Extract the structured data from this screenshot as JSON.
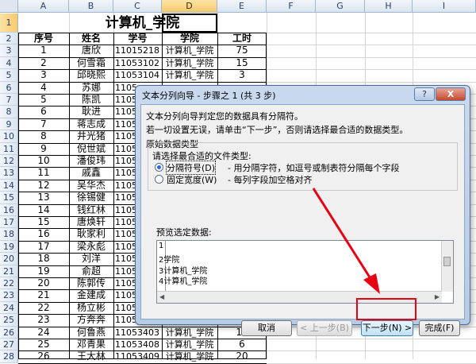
{
  "sheet": {
    "columns": [
      "A",
      "B",
      "C",
      "D",
      "E",
      "F",
      "G",
      "H",
      "I"
    ],
    "selected_column": "D",
    "title": "计算机_学院",
    "headers": [
      "序号",
      "姓名",
      "学号",
      "学院",
      "工时"
    ],
    "rows": [
      {
        "num": "1",
        "name": "唐欣",
        "id": "11015218",
        "dept": "计算机_学院",
        "hours": "75"
      },
      {
        "num": "2",
        "name": "何雪霜",
        "id": "11053102",
        "dept": "计算机_学院",
        "hours": "15"
      },
      {
        "num": "3",
        "name": "邱晓熙",
        "id": "11053104",
        "dept": "计算机_学院",
        "hours": "3"
      },
      {
        "num": "4",
        "name": "苏娜",
        "id": "1105",
        "dept": "",
        "hours": ""
      },
      {
        "num": "5",
        "name": "陈凯",
        "id": "1105",
        "dept": "",
        "hours": ""
      },
      {
        "num": "6",
        "name": "耿进",
        "id": "1105",
        "dept": "",
        "hours": ""
      },
      {
        "num": "7",
        "name": "蒋志成",
        "id": "1105",
        "dept": "",
        "hours": ""
      },
      {
        "num": "8",
        "name": "井光猪",
        "id": "1105",
        "dept": "",
        "hours": ""
      },
      {
        "num": "9",
        "name": "倪世斌",
        "id": "1105",
        "dept": "",
        "hours": ""
      },
      {
        "num": "10",
        "name": "潘俊玮",
        "id": "1105",
        "dept": "",
        "hours": ""
      },
      {
        "num": "11",
        "name": "戚鑫",
        "id": "1105",
        "dept": "",
        "hours": ""
      },
      {
        "num": "12",
        "name": "吴华杰",
        "id": "1105",
        "dept": "",
        "hours": ""
      },
      {
        "num": "13",
        "name": "徐锡健",
        "id": "1105",
        "dept": "",
        "hours": ""
      },
      {
        "num": "14",
        "name": "钱红林",
        "id": "1105",
        "dept": "",
        "hours": ""
      },
      {
        "num": "15",
        "name": "唐焕轩",
        "id": "1105",
        "dept": "",
        "hours": ""
      },
      {
        "num": "16",
        "name": "耿家利",
        "id": "1105",
        "dept": "",
        "hours": ""
      },
      {
        "num": "17",
        "name": "梁永彪",
        "id": "1105",
        "dept": "",
        "hours": ""
      },
      {
        "num": "18",
        "name": "刘洋",
        "id": "1105",
        "dept": "",
        "hours": ""
      },
      {
        "num": "19",
        "name": "俞超",
        "id": "1105",
        "dept": "",
        "hours": ""
      },
      {
        "num": "20",
        "name": "陈郭传",
        "id": "1105",
        "dept": "",
        "hours": ""
      },
      {
        "num": "21",
        "name": "金建成",
        "id": "1105",
        "dept": "",
        "hours": ""
      },
      {
        "num": "22",
        "name": "杨立彬",
        "id": "1105",
        "dept": "",
        "hours": ""
      },
      {
        "num": "23",
        "name": "方奔奔",
        "id": "1105",
        "dept": "",
        "hours": ""
      },
      {
        "num": "24",
        "name": "何鲁燕",
        "id": "11053403",
        "dept": "计算机_学院",
        "hours": "15"
      },
      {
        "num": "25",
        "name": "邓青果",
        "id": "11053408",
        "dept": "计算机_学院",
        "hours": "6"
      },
      {
        "num": "26",
        "name": "王大林",
        "id": "11053409",
        "dept": "计算机_学院",
        "hours": "20"
      }
    ]
  },
  "dialog": {
    "title": "文本分列向导 - 步骤之 1 (共 3 步)",
    "help_label": "?",
    "close_label": "X",
    "intro1": "文本分列向导判定您的数据具有分隔符。",
    "intro2": "若一切设置无误，请单击“下一步”，否则请选择最合适的数据类型。",
    "group_label": "原始数据类型",
    "group_prompt": "请选择最合适的文件类型:",
    "option_delimited": "分隔符号(D)",
    "option_delimited_desc": "- 用分隔字符，如逗号或制表符分隔每个字段",
    "option_fixed": "固定宽度(W)",
    "option_fixed_desc": "- 每列字段加空格对齐",
    "preview_label": "预览选定数据:",
    "preview_lines": [
      "1",
      "2学院",
      "3计算机_学院",
      "4计算机_学院"
    ],
    "buttons": {
      "cancel": "取消",
      "back": "< 上一步(B)",
      "next": "下一步(N) >",
      "finish": "完成(F)"
    }
  },
  "colors": {
    "highlight": "#e60012",
    "arrow": "#e60012",
    "selected_header": "#f7c96b"
  }
}
